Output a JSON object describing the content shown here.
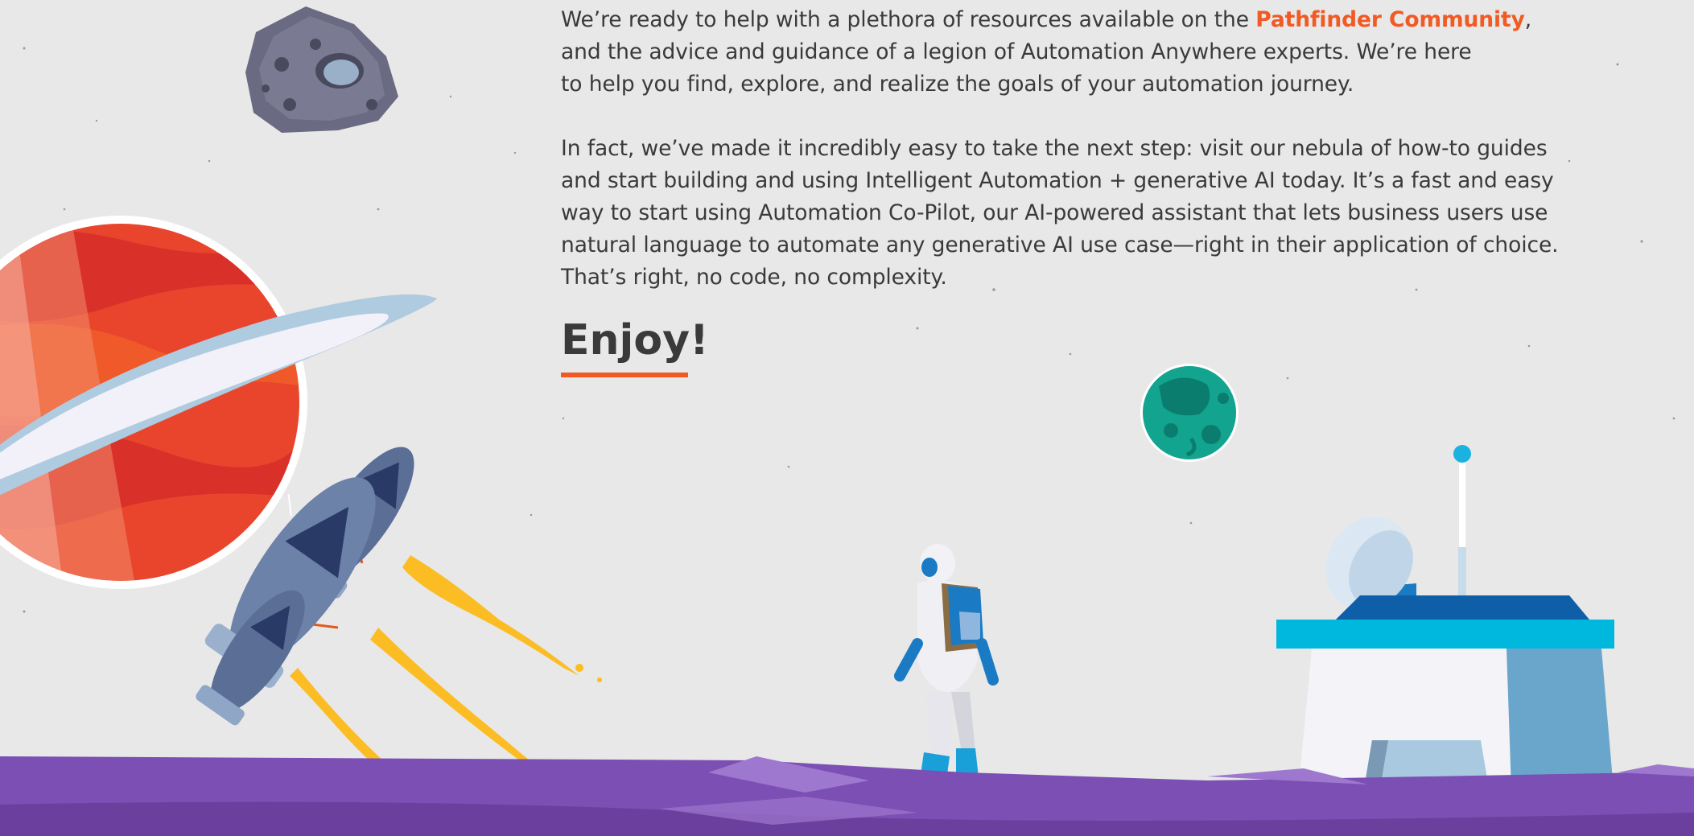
{
  "content": {
    "para1_lead": "We’re ready to help with a plethora of resources available on the ",
    "para1_link": "Pathfinder Community",
    "para1_rest": ",\nand the advice and guidance of a legion of Automation Anywhere experts. We’re here\nto help you find, explore, and realize the goals of your automation journey.",
    "para2": "In fact, we’ve made it incredibly easy to take the next step: visit our nebula of how-to guides\nand start building and using Intelligent Automation + generative AI today. It’s a fast and easy\nway to start using Automation Co-Pilot, our AI-powered assistant that lets business users use\nnatural language to automate any generative AI use case—right in their application of choice.\nThat’s right, no code, no complexity.",
    "heading": "Enjoy!"
  },
  "theme": {
    "background": "#e8e8e8",
    "text": "#3a3a3a",
    "accent": "#f15a22",
    "ground": "#7b4fb3"
  },
  "illustration": {
    "items": [
      "asteroid",
      "ringed-planet",
      "rocket-ships",
      "green-planet",
      "astronaut",
      "radar-station",
      "purple-ground"
    ]
  }
}
